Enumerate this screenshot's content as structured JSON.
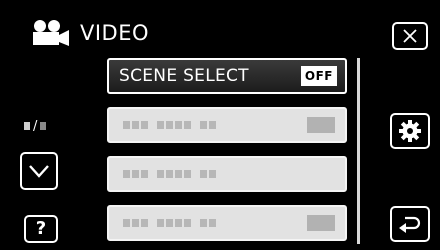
{
  "header": {
    "title": "VIDEO",
    "title_icon": "video-camera-icon"
  },
  "page_indicator": {
    "separator": "/"
  },
  "menu": {
    "items": [
      {
        "label": "SCENE SELECT",
        "value": "OFF",
        "selected": true
      },
      {
        "label": "",
        "value": "",
        "selected": false
      },
      {
        "label": "",
        "value": "",
        "selected": false
      },
      {
        "label": "",
        "value": "",
        "selected": false
      }
    ]
  },
  "buttons": {
    "close_icon": "close-x-icon",
    "settings_icon": "gear-icon",
    "back_icon": "return-arrow-icon",
    "scroll_down_icon": "chevron-down-icon",
    "help_label": "?"
  },
  "colors": {
    "background": "#000000",
    "foreground": "#ffffff",
    "row_inactive": "#e2e2e2",
    "row_selected": "#2a2a2a"
  }
}
